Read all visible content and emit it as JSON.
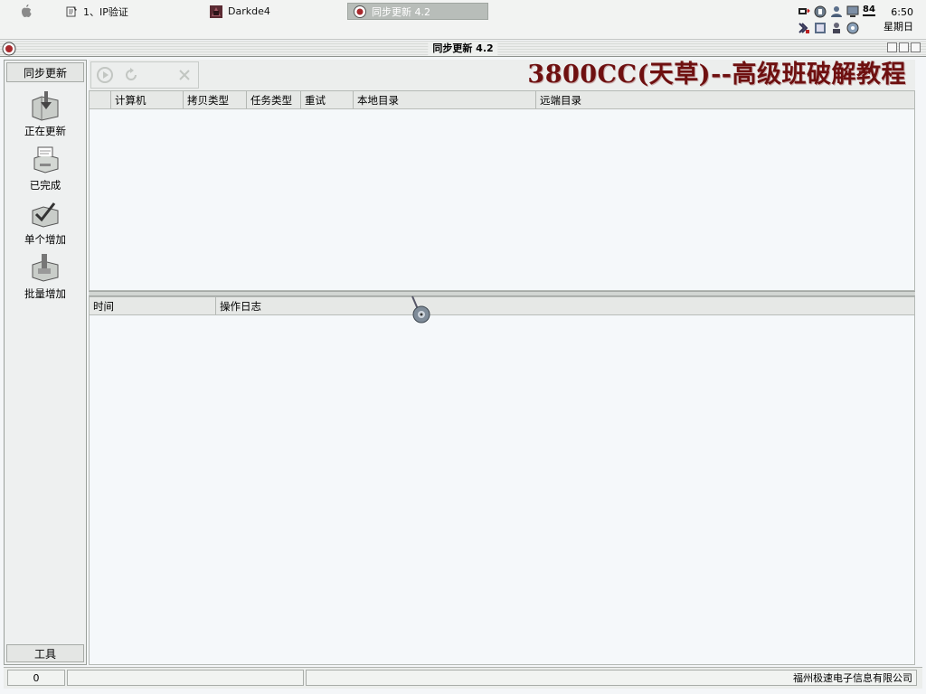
{
  "taskbar": {
    "tasks": [
      {
        "label": "1、IP验证"
      },
      {
        "label": "Darkde4"
      },
      {
        "label": "同步更新 4.2"
      }
    ],
    "tray_badge": "84",
    "time": "6:50",
    "day": "星期日"
  },
  "window": {
    "title": "同步更新 4.2"
  },
  "watermark": "3800CC(天草)--高级班破解教程",
  "sidebar": {
    "header": "同步更新",
    "items": [
      {
        "label": "正在更新",
        "icon": "download-folder-icon"
      },
      {
        "label": "已完成",
        "icon": "printer-icon"
      },
      {
        "label": "单个增加",
        "icon": "add-single-icon"
      },
      {
        "label": "批量增加",
        "icon": "add-batch-icon"
      }
    ],
    "footer": "工具"
  },
  "tasks_table": {
    "columns": [
      "",
      "计算机",
      "拷贝类型",
      "任务类型",
      "重试",
      "本地目录",
      "远端目录"
    ]
  },
  "log_table": {
    "columns": [
      "时间",
      "操作日志"
    ]
  },
  "status": {
    "count": "0",
    "company": "福州极速电子信息有限公司"
  },
  "colors": {
    "watermark": "#6e1010",
    "active_task": "#b8bdb9"
  }
}
